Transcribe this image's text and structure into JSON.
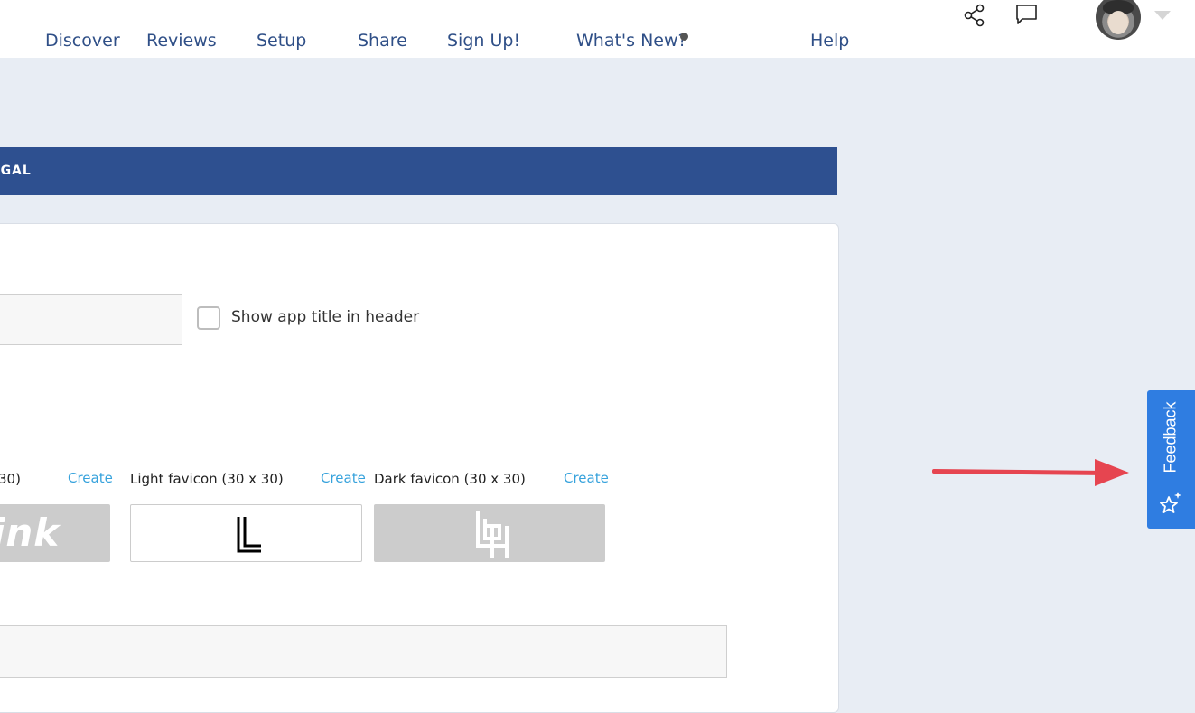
{
  "nav": {
    "items": [
      {
        "label": "Discover"
      },
      {
        "label": "Reviews"
      },
      {
        "label": "Setup"
      },
      {
        "label": "Share"
      },
      {
        "label": "Sign Up!"
      },
      {
        "label": "What's New?"
      },
      {
        "label": "Help"
      }
    ]
  },
  "header_icons": [
    "share-icon",
    "comment-icon",
    "avatar",
    "chevron-down-icon"
  ],
  "section": {
    "band_label": "EGAL"
  },
  "form": {
    "app_title_value": "",
    "show_title_label": "Show app title in header",
    "favicons": [
      {
        "label": "30)",
        "create": "Create",
        "preview_text": "ink",
        "background": "#cccccc"
      },
      {
        "label": "Light favicon (30 x 30)",
        "create": "Create",
        "preview_glyph": "L",
        "background": "#ffffff"
      },
      {
        "label": "Dark favicon (30 x 30)",
        "create": "Create",
        "preview_glyph": "logo",
        "background": "#cccccc"
      }
    ],
    "bottom_field_value": ""
  },
  "feedback": {
    "label": "Feedback",
    "icon": "sparkle-star-icon"
  },
  "colors": {
    "nav_text": "#2f4f87",
    "band": "#2e5090",
    "link": "#36a2dc",
    "feedback_bg": "#2f7de1",
    "arrow": "#e64550",
    "page_bg": "#e8edf4"
  }
}
